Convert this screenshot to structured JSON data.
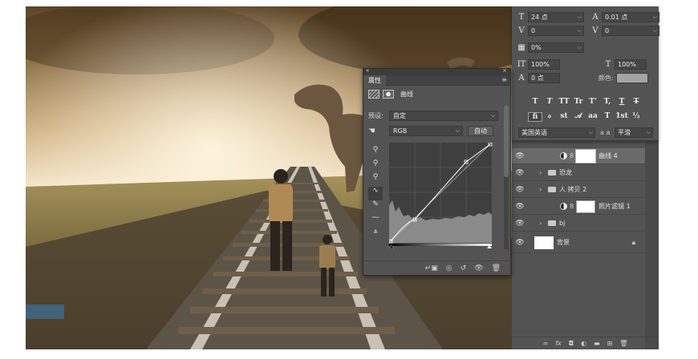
{
  "colors": {
    "panel_bg": "#535353",
    "panel_dark": "#3c3c3c",
    "field_bg": "#454545",
    "selected_layer": "#6a6a6a",
    "text": "#e6e6e6"
  },
  "character_panel": {
    "font_size": "24 点",
    "leading": "0.01 点",
    "kerning": "0",
    "tracking": "0",
    "tsume": "0%",
    "vertical_scale": "100%",
    "horizontal_scale": "100%",
    "baseline_shift": "0 点",
    "color_label": "颜色:",
    "language": "美国英语",
    "antialias_label": "a a",
    "antialias": "平滑",
    "style_glyphs": [
      "T",
      "T",
      "TT",
      "Tr",
      "T'",
      "T,",
      "T",
      "T"
    ],
    "opentype_glyphs": [
      "fi",
      "ℴ",
      "st",
      "𝒜",
      "aa",
      "T",
      "1st",
      "½"
    ]
  },
  "properties_panel": {
    "tab_label": "属性",
    "title": "曲线",
    "preset_label": "预设:",
    "preset_value": "自定",
    "channel_value": "RGB",
    "auto_button": "自动",
    "tool_icons": [
      "eyedropper-black",
      "eyedropper-gray",
      "eyedropper-white",
      "curve-tool",
      "pencil-tool",
      "smooth-tool",
      "clipping-warning"
    ],
    "footer_icons": [
      "clip-to-layer",
      "view-previous",
      "reset",
      "visibility",
      "delete"
    ]
  },
  "layers": [
    {
      "name": "曲线 4",
      "type": "adjustment",
      "selected": true
    },
    {
      "name": "恐龙",
      "type": "group"
    },
    {
      "name": "人 拷贝 2",
      "type": "group"
    },
    {
      "name": "照片滤镜 1",
      "type": "adjustment"
    },
    {
      "name": "bj",
      "type": "group"
    },
    {
      "name": "背景",
      "type": "background",
      "locked": true
    }
  ],
  "layer_footer": [
    "link",
    "fx",
    "mask",
    "adjustment",
    "folder",
    "new-layer",
    "trash"
  ]
}
